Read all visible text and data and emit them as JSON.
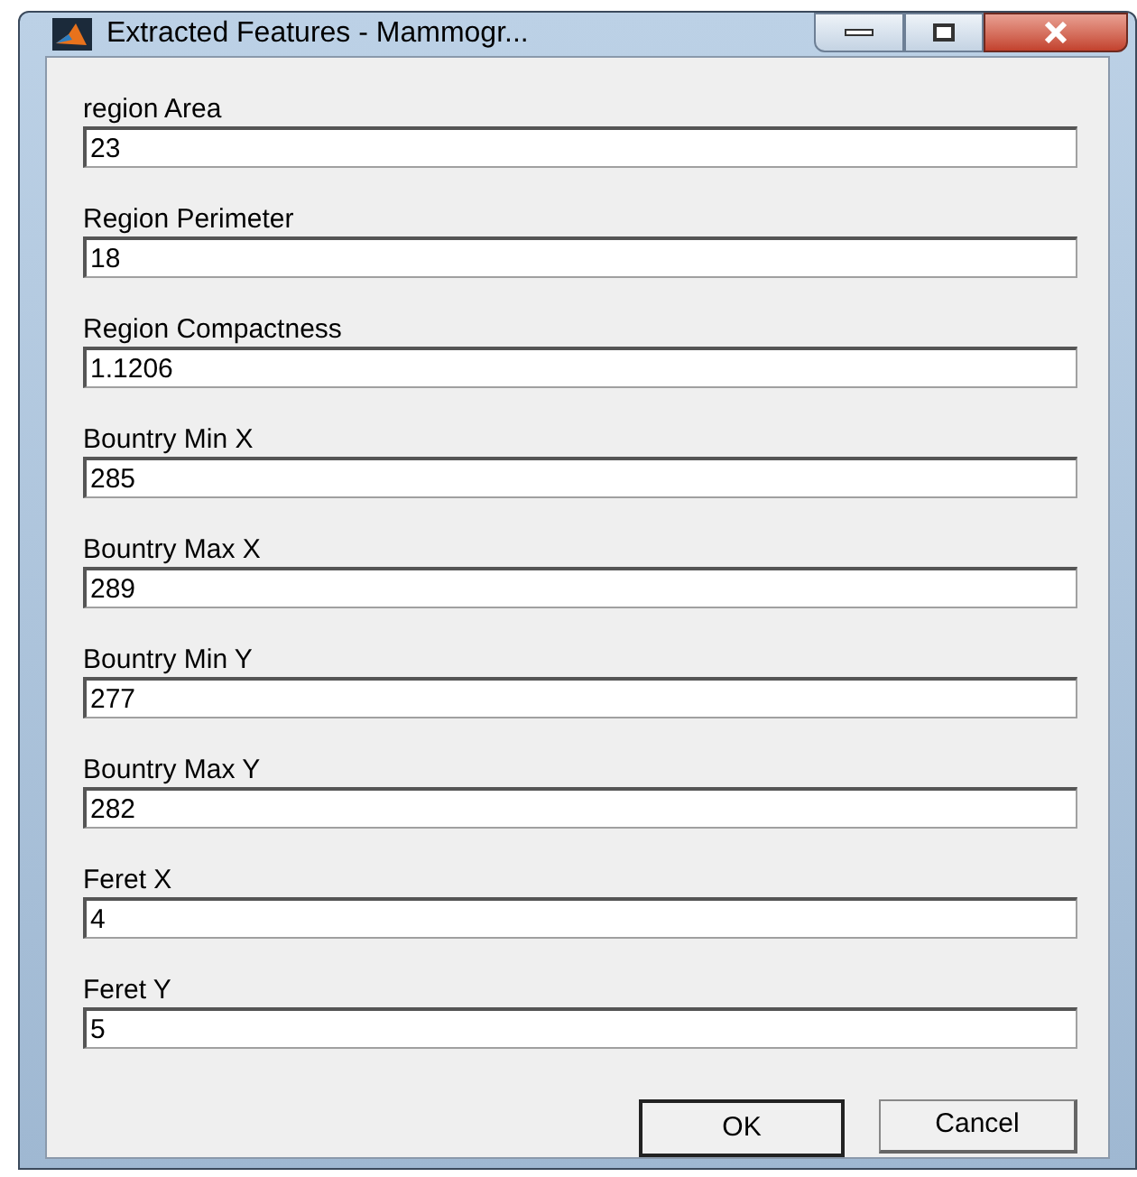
{
  "window": {
    "title": "Extracted Features - Mammogr..."
  },
  "fields": [
    {
      "label": "region Area",
      "value": "23"
    },
    {
      "label": "Region Perimeter",
      "value": "18"
    },
    {
      "label": "Region Compactness",
      "value": "1.1206"
    },
    {
      "label": "Bountry Min X",
      "value": "285"
    },
    {
      "label": "Bountry Max X",
      "value": "289"
    },
    {
      "label": "Bountry Min Y",
      "value": "277"
    },
    {
      "label": "Bountry Max Y",
      "value": "282"
    },
    {
      "label": "Feret X",
      "value": "4"
    },
    {
      "label": "Feret Y",
      "value": "5"
    }
  ],
  "buttons": [
    {
      "label": "OK",
      "default": true
    },
    {
      "label": "Cancel",
      "default": false
    }
  ]
}
